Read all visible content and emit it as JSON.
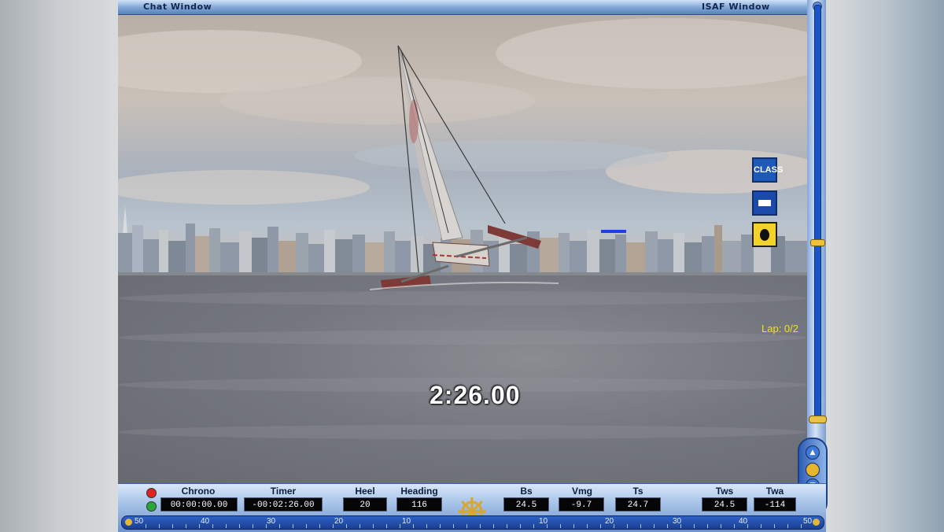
{
  "top_bar": {
    "chat_window": "Chat Window",
    "isaf_window": "ISAF Window"
  },
  "overlay": {
    "race_timer": "2:26.00",
    "lap": "Lap: 0/2",
    "class_flag": "CLASS"
  },
  "colors": {
    "accent_blue": "#1e58b8",
    "hud_yellow": "#f3e11a",
    "panel_blue": "#a7c3e8"
  },
  "dashboard": {
    "chrono": {
      "label": "Chrono",
      "value": "00:00:00.00"
    },
    "timer": {
      "label": "Timer",
      "value": "-00:02:26.00"
    },
    "heel": {
      "label": "Heel",
      "value": "20"
    },
    "heading": {
      "label": "Heading",
      "value": "116"
    },
    "bs": {
      "label": "Bs",
      "value": "24.5"
    },
    "vmg": {
      "label": "Vmg",
      "value": "-9.7"
    },
    "ts": {
      "label": "Ts",
      "value": "24.7"
    },
    "tws": {
      "label": "Tws",
      "value": "24.5"
    },
    "twa": {
      "label": "Twa",
      "value": "-114"
    }
  },
  "compass_scale": [
    "50",
    "40",
    "30",
    "20",
    "10",
    "10",
    "20",
    "30",
    "40",
    "50"
  ],
  "icons": {
    "helm": "ship-wheel-icon",
    "indicator_red": "status-led-red",
    "indicator_green": "status-led-green"
  }
}
